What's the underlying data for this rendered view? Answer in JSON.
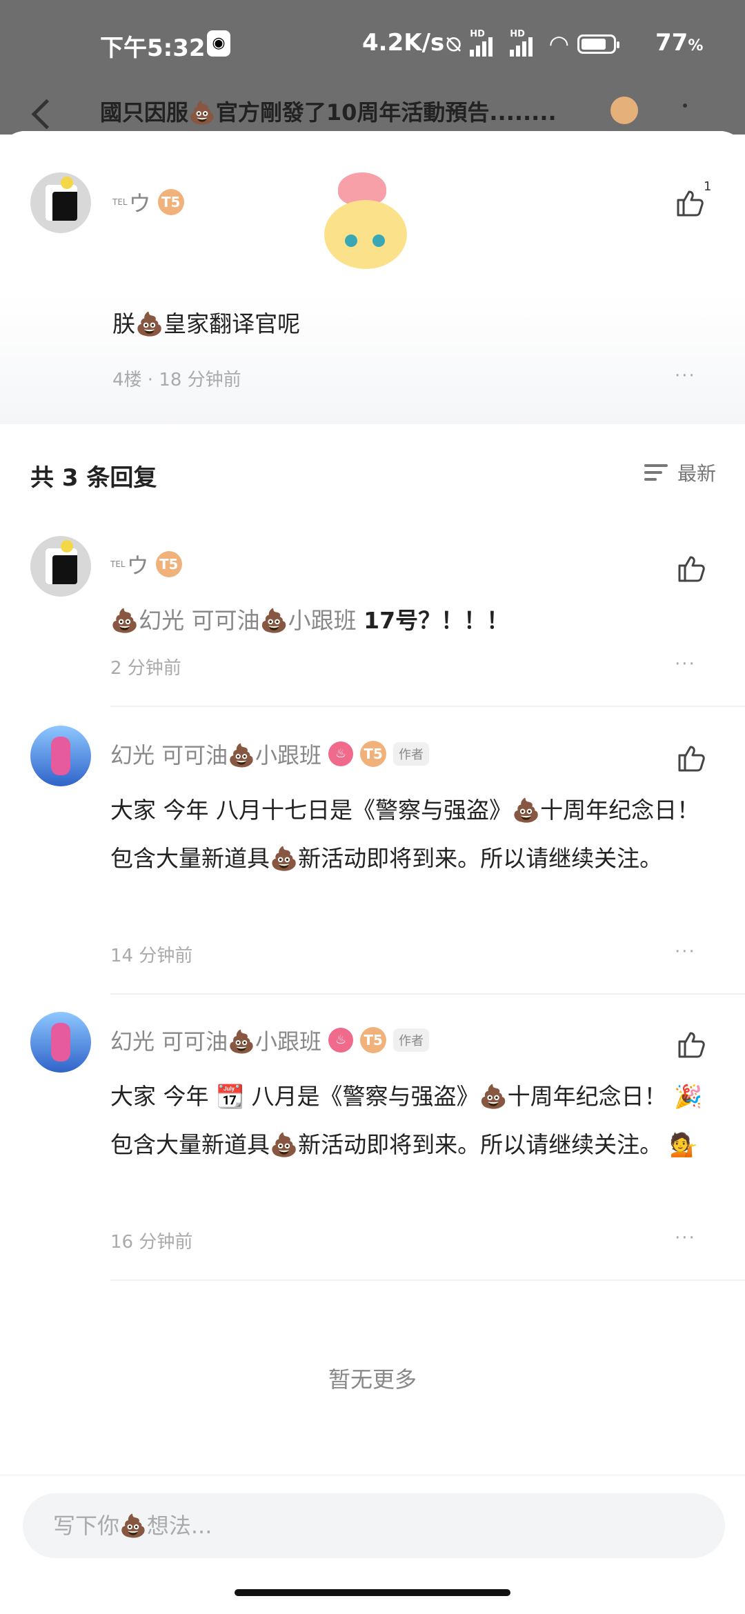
{
  "status_bar": {
    "time": "下午5:32",
    "net_speed": "4.2K/s",
    "battery_pct": "77",
    "battery_unit": "%",
    "hd1": "HD",
    "hd2": "HD"
  },
  "background_page": {
    "title": "國只因服💩官方剛發了10周年活動預告........"
  },
  "top_comment": {
    "user_tag": "TEL",
    "user_name": "ウ",
    "badge": "T5",
    "likes": "1",
    "text": "朕💩皇家翻译官呢",
    "meta": "4楼 · 18 分钟前",
    "more": "···"
  },
  "replies_header": {
    "title": "共 3 条回复",
    "sort_label": "最新"
  },
  "replies": [
    {
      "user_tag": "TEL",
      "user_name": "ウ",
      "badge": "T5",
      "text_prefix": "💩幻光 可可油💩小跟班",
      "text_main": "17号？！！！",
      "time": "2 分钟前",
      "more": "···"
    },
    {
      "user_name": "幻光 可可油💩小跟班",
      "badge": "T5",
      "author_tag": "作者",
      "text": "大家 今年 八月十七日是《警察与强盗》💩十周年纪念日！  包含大量新道具💩新活动即将到来。所以请继续关注。",
      "time": "14 分钟前",
      "more": "···"
    },
    {
      "user_name": "幻光 可可油💩小跟班",
      "badge": "T5",
      "author_tag": "作者",
      "text": "大家 今年 📆 八月是《警察与强盗》💩十周年纪念日！ 🎉 包含大量新道具💩新活动即将到来。所以请继续关注。 💁",
      "time": "16 分钟前",
      "more": "···"
    }
  ],
  "no_more": "暂无更多",
  "input": {
    "placeholder": "写下你💩想法..."
  },
  "icons": {
    "like": "thumbs-up-icon",
    "sort": "sort-icon",
    "back": "back-arrow-icon"
  }
}
